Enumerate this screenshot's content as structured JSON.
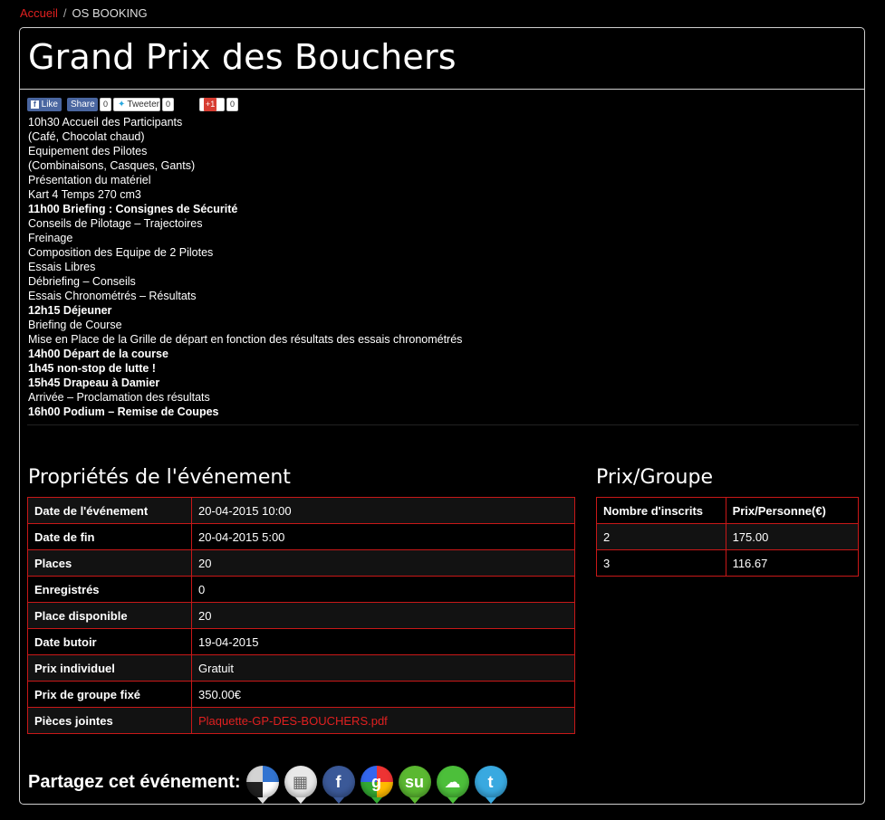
{
  "breadcrumb": {
    "home": "Accueil",
    "separator": "/",
    "current": "OS BOOKING"
  },
  "event": {
    "title": "Grand Prix des Bouchers"
  },
  "social_bar": {
    "like": "Like",
    "share": "Share",
    "share_count": "0",
    "tweet": "Tweeter",
    "tweet_count": "0",
    "gplus": "+1",
    "gplus_count": "0"
  },
  "schedule": [
    {
      "text": "10h30 Accueil des Participants",
      "bold": false
    },
    {
      "text": "(Café, Chocolat chaud)",
      "bold": false
    },
    {
      "text": "Equipement des Pilotes",
      "bold": false
    },
    {
      "text": "(Combinaisons, Casques, Gants)",
      "bold": false
    },
    {
      "text": "Présentation du matériel",
      "bold": false
    },
    {
      "text": "Kart 4 Temps 270 cm3",
      "bold": false
    },
    {
      "text": "11h00 Briefing : Consignes de Sécurité",
      "bold": true
    },
    {
      "text": "Conseils de Pilotage – Trajectoires",
      "bold": false
    },
    {
      "text": "Freinage",
      "bold": false
    },
    {
      "text": "Composition des Equipe de 2 Pilotes",
      "bold": false
    },
    {
      "text": "Essais Libres",
      "bold": false
    },
    {
      "text": "Débriefing – Conseils",
      "bold": false
    },
    {
      "text": "Essais Chronométrés – Résultats",
      "bold": false
    },
    {
      "text": "12h15 Déjeuner",
      "bold": true
    },
    {
      "text": "Briefing de Course",
      "bold": false
    },
    {
      "text": "Mise en Place de la Grille de départ en fonction des résultats des essais chronométrés",
      "bold": false
    },
    {
      "text": "14h00 Départ de la course",
      "bold": true
    },
    {
      "text": "1h45 non-stop de lutte !",
      "bold": true
    },
    {
      "text": "15h45 Drapeau à Damier",
      "bold": true
    },
    {
      "text": "Arrivée – Proclamation des résultats",
      "bold": false
    },
    {
      "text": "16h00 Podium – Remise de Coupes",
      "bold": true
    }
  ],
  "properties": {
    "title": "Propriétés de l'événement",
    "rows": [
      {
        "label": "Date de l'événement",
        "value": "20-04-2015 10:00"
      },
      {
        "label": "Date de fin",
        "value": "20-04-2015 5:00"
      },
      {
        "label": "Places",
        "value": "20"
      },
      {
        "label": "Enregistrés",
        "value": "0"
      },
      {
        "label": "Place disponible",
        "value": "20"
      },
      {
        "label": "Date butoir",
        "value": "19-04-2015"
      },
      {
        "label": "Prix individuel",
        "value": "Gratuit"
      },
      {
        "label": "Prix de groupe fixé",
        "value": "350.00€"
      },
      {
        "label": "Pièces jointes",
        "value": "Plaquette-GP-DES-BOUCHERS.pdf",
        "link": true
      }
    ]
  },
  "group_price": {
    "title": "Prix/Groupe",
    "headers": [
      "Nombre d'inscrits",
      "Prix/Personne(€)"
    ],
    "rows": [
      [
        "2",
        "175.00"
      ],
      [
        "3",
        "116.67"
      ]
    ]
  },
  "share_event": {
    "label": "Partagez cet événement:",
    "icons": [
      {
        "name": "delicious-icon",
        "color": "#f0f0f0"
      },
      {
        "name": "digg-icon",
        "color": "#e8e8e8"
      },
      {
        "name": "facebook-icon",
        "color": "#3b5998"
      },
      {
        "name": "google-icon",
        "color": "#4a8af4"
      },
      {
        "name": "stumbleupon-icon",
        "color": "#5bb831"
      },
      {
        "name": "chat-icon",
        "color": "#4cbf3a"
      },
      {
        "name": "twitter-icon",
        "color": "#39a9e0"
      }
    ]
  },
  "colors": {
    "accent": "#c81818",
    "link": "#e02020",
    "background": "#000000"
  }
}
